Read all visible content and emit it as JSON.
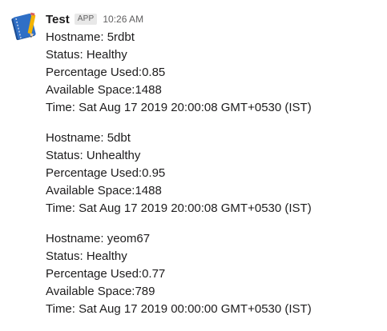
{
  "message": {
    "sender": "Test",
    "badge": "APP",
    "time": "10:26 AM",
    "blocks": [
      {
        "hostname": "Hostname: 5rdbt",
        "status": "Status: Healthy",
        "percentage": "Percentage Used:0.85",
        "space": "Available Space:1488",
        "time": "Time: Sat Aug 17 2019 20:00:08 GMT+0530 (IST)"
      },
      {
        "hostname": "Hostname: 5dbt",
        "status": "Status: Unhealthy",
        "percentage": "Percentage Used:0.95",
        "space": "Available Space:1488",
        "time": "Time: Sat Aug 17 2019 20:00:08 GMT+0530 (IST)"
      },
      {
        "hostname": "Hostname: yeom67",
        "status": "Status: Healthy",
        "percentage": "Percentage Used:0.77",
        "space": "Available Space:789",
        "time": "Time: Sat Aug 17 2019 00:00:00 GMT+0530 (IST)"
      }
    ]
  },
  "colors": {
    "text": "#1d1c1d",
    "muted": "#616061",
    "badge_bg": "#e8e8e8",
    "avatar_blue": "#2f6fc6",
    "avatar_pencil": "#f4b400"
  },
  "icons": {
    "avatar": "notebook-pencil-icon"
  }
}
